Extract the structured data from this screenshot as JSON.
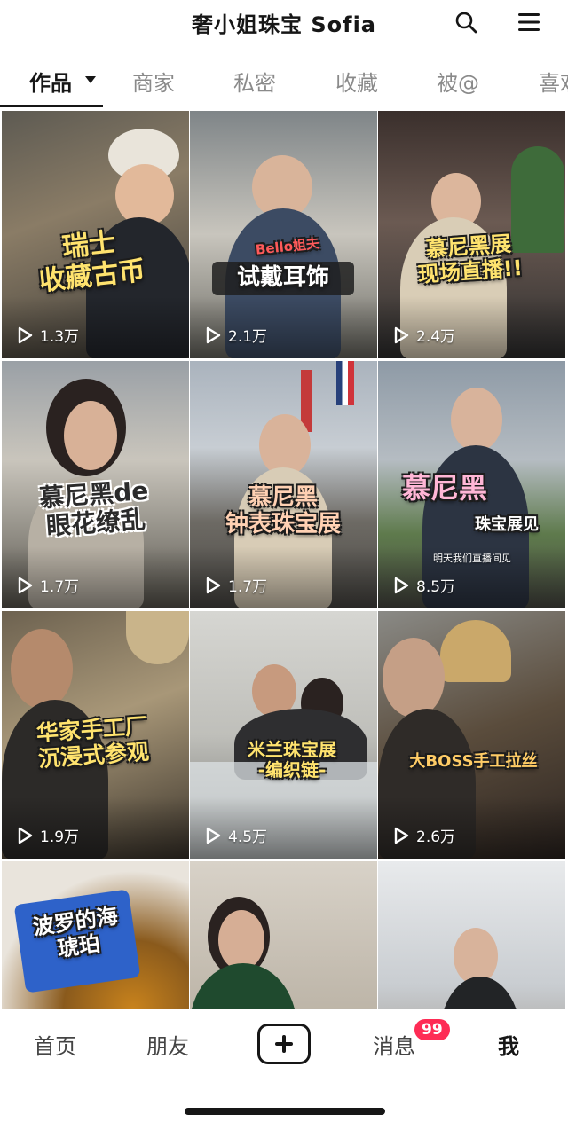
{
  "header": {
    "title": "奢小姐珠宝 Sofia",
    "search_icon": "search-icon",
    "menu_icon": "hamburger-menu-icon"
  },
  "tabs": [
    {
      "label": "作品",
      "active": true
    },
    {
      "label": "商家",
      "active": false
    },
    {
      "label": "私密",
      "active": false
    },
    {
      "label": "收藏",
      "active": false
    },
    {
      "label": "被@",
      "active": false
    },
    {
      "label": "喜欢",
      "active": false
    }
  ],
  "videos": [
    {
      "caption": "瑞士\n收藏古币",
      "plays": "1.3万"
    },
    {
      "overlay_tag": "Bello姐夫",
      "caption": "试戴耳饰",
      "plays": "2.1万"
    },
    {
      "caption": "慕尼黑展\n现场直播!!",
      "plays": "2.4万"
    },
    {
      "caption": "慕尼黑de\n眼花缭乱",
      "plays": "1.7万"
    },
    {
      "caption": "慕尼黑\n钟表珠宝展",
      "plays": "1.7万"
    },
    {
      "caption": "慕尼黑",
      "sub_caption": "珠宝展见",
      "note": "明天我们直播间见",
      "plays": "8.5万"
    },
    {
      "caption": "华家手工厂\n沉浸式参观",
      "plays": "1.9万"
    },
    {
      "caption": "米兰珠宝展\n-编织链-",
      "plays": "4.5万"
    },
    {
      "caption": "大BOSS手工拉丝",
      "plays": "2.6万"
    },
    {
      "caption": "波罗的海\n琥珀",
      "plays": ""
    },
    {
      "caption": "",
      "plays": ""
    },
    {
      "caption": "",
      "plays": ""
    }
  ],
  "bottom_nav": {
    "home": "首页",
    "friends": "朋友",
    "create_icon": "plus-icon",
    "messages": "消息",
    "messages_badge": "99",
    "me": "我"
  },
  "colors": {
    "accent_badge": "#fe2c55",
    "caption_yellow": "#ffe36e",
    "text_primary": "#161616",
    "text_inactive": "#8a8a8a"
  }
}
